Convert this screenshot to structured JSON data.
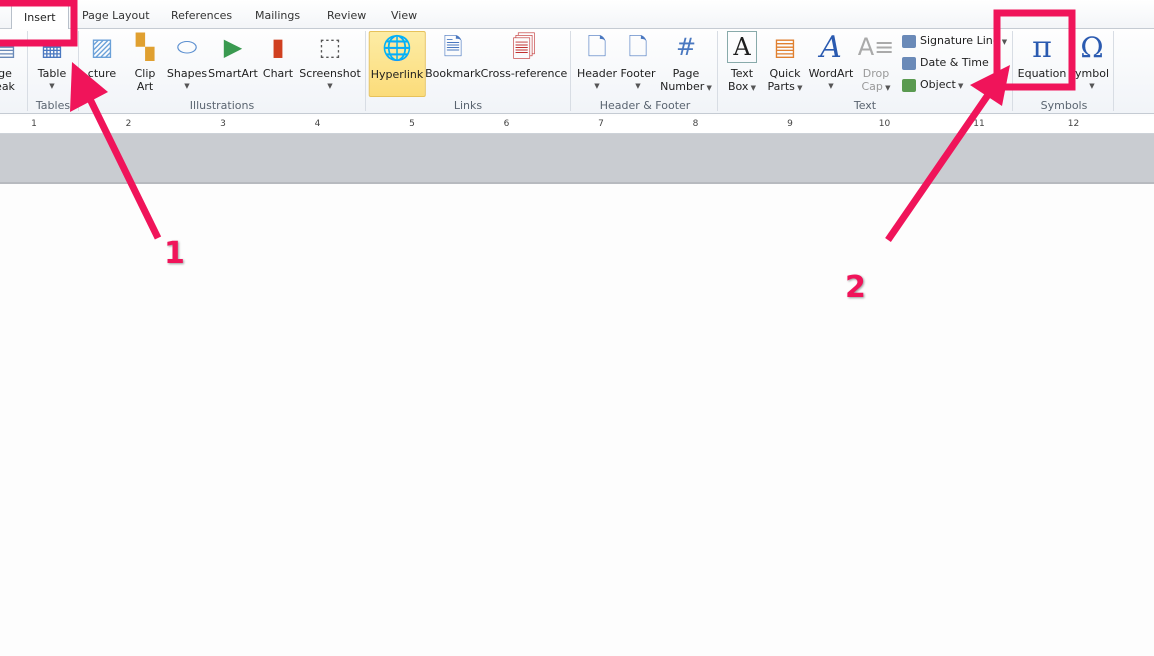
{
  "tabs": [
    {
      "label": "Insert",
      "active": true
    },
    {
      "label": "Page Layout"
    },
    {
      "label": "References"
    },
    {
      "label": "Mailings"
    },
    {
      "label": "Review"
    },
    {
      "label": "View"
    }
  ],
  "groups": {
    "tables": "Tables",
    "illustrations": "Illustrations",
    "links": "Links",
    "header_footer": "Header & Footer",
    "text": "Text",
    "symbols": "Symbols"
  },
  "buttons": {
    "page_break": [
      "ge",
      "eak"
    ],
    "table": "Table",
    "picture": "cture",
    "clip_art": [
      "Clip",
      "Art"
    ],
    "shapes": "Shapes",
    "smartart": "SmartArt",
    "chart": "Chart",
    "screenshot": "Screenshot",
    "hyperlink": "Hyperlink",
    "bookmark": "Bookmark",
    "cross_reference": "Cross-reference",
    "header": "Header",
    "footer": "Footer",
    "page_number": [
      "Page",
      "Number"
    ],
    "text_box": [
      "Text",
      "Box"
    ],
    "quick_parts": [
      "Quick",
      "Parts"
    ],
    "wordart": "WordArt",
    "drop_cap": [
      "Drop",
      "Cap"
    ],
    "signature_line": "Signature Line",
    "date_time": "Date & Time",
    "object": "Object",
    "equation": "Equation",
    "symbol": "ymbol"
  },
  "icons": {
    "equation": "π",
    "symbol": "Ω",
    "wordart": "A"
  },
  "ruler": [
    "1",
    "2",
    "3",
    "4",
    "5",
    "6",
    "7",
    "8",
    "9",
    "10",
    "11",
    "12"
  ],
  "annotations": {
    "step1": "1",
    "step2": "2",
    "color": "#f0145a"
  }
}
